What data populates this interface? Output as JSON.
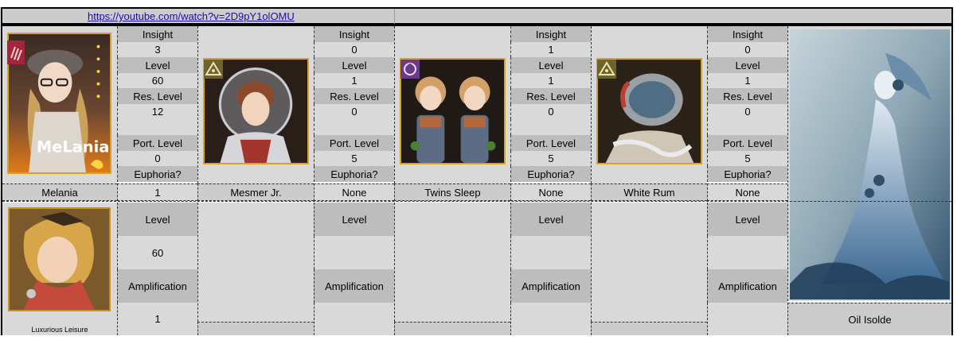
{
  "header": {
    "url": "https://youtube.com/watch?v=2D9pY1olOMU"
  },
  "stat_labels": {
    "insight": "Insight",
    "level": "Level",
    "res_level": "Res. Level",
    "port_level": "Port. Level",
    "euphoria": "Euphoria?",
    "amplification": "Amplification"
  },
  "characters": [
    {
      "name": "Melania",
      "insight": "3",
      "level": "60",
      "res_level": "12",
      "port_level": "0",
      "euphoria": "1",
      "psychube": {
        "name": "Luxurious Leisure",
        "level": "60",
        "amplification": "1"
      }
    },
    {
      "name": "Mesmer Jr.",
      "insight": "0",
      "level": "1",
      "res_level": "0",
      "port_level": "5",
      "euphoria": "None",
      "psychube": {
        "name": "",
        "level": "",
        "amplification": ""
      }
    },
    {
      "name": "Twins Sleep",
      "insight": "1",
      "level": "1",
      "res_level": "0",
      "port_level": "5",
      "euphoria": "None",
      "psychube": {
        "name": "",
        "level": "",
        "amplification": ""
      }
    },
    {
      "name": "White Rum",
      "insight": "0",
      "level": "1",
      "res_level": "0",
      "port_level": "5",
      "euphoria": "None",
      "psychube": {
        "name": "",
        "level": "",
        "amplification": ""
      }
    }
  ],
  "special": {
    "name": "Oil Isolde"
  },
  "icons": {
    "melania_badge": "claw-icon",
    "mesmer_badge": "pyramid-eye-icon",
    "twins_badge": "crescent-moon-icon",
    "rum_badge": "pyramid-eye-icon"
  }
}
